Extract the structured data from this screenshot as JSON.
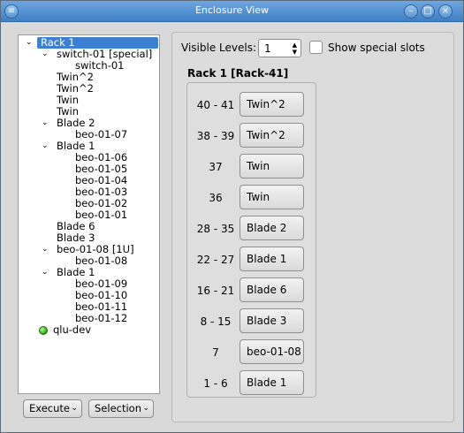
{
  "window": {
    "title": "Enclosure View"
  },
  "tree": {
    "rows": [
      {
        "label": "Rack 1",
        "arrow": "⌄",
        "selected": true
      },
      {
        "label": "switch-01 [special]",
        "arrow": "⌄"
      },
      {
        "label": "switch-01"
      },
      {
        "label": "Twin^2"
      },
      {
        "label": "Twin^2"
      },
      {
        "label": "Twin"
      },
      {
        "label": "Twin"
      },
      {
        "label": "Blade 2",
        "arrow": "⌄"
      },
      {
        "label": "beo-01-07"
      },
      {
        "label": "Blade 1",
        "arrow": "⌄"
      },
      {
        "label": "beo-01-06"
      },
      {
        "label": "beo-01-05"
      },
      {
        "label": "beo-01-04"
      },
      {
        "label": "beo-01-03"
      },
      {
        "label": "beo-01-02"
      },
      {
        "label": "beo-01-01"
      },
      {
        "label": "Blade 6"
      },
      {
        "label": "Blade 3"
      },
      {
        "label": "beo-01-08 [1U]",
        "arrow": "⌄"
      },
      {
        "label": "beo-01-08"
      },
      {
        "label": "Blade 1",
        "arrow": "⌄"
      },
      {
        "label": "beo-01-09"
      },
      {
        "label": "beo-01-10"
      },
      {
        "label": "beo-01-11"
      },
      {
        "label": "beo-01-12"
      },
      {
        "label": "qlu-dev",
        "status": "online"
      }
    ]
  },
  "buttons": {
    "execute": "Execute",
    "selection": "Selection",
    "caret": "⌄"
  },
  "controls": {
    "visible_levels_label": "Visible Levels:",
    "visible_levels_value": "1",
    "show_special_label": "Show special slots",
    "show_special_checked": false
  },
  "rack": {
    "title": "Rack 1 [Rack-41]",
    "slots": [
      {
        "range": "40 - 41",
        "name": "Twin^2"
      },
      {
        "range": "38 - 39",
        "name": "Twin^2"
      },
      {
        "range": "37",
        "name": "Twin"
      },
      {
        "range": "36",
        "name": "Twin"
      },
      {
        "range": "28 - 35",
        "name": "Blade 2"
      },
      {
        "range": "22 - 27",
        "name": "Blade 1"
      },
      {
        "range": "16 - 21",
        "name": "Blade 6"
      },
      {
        "range": "8 - 15",
        "name": "Blade 3"
      },
      {
        "range": "7",
        "name": "beo-01-08"
      },
      {
        "range": "1 - 6",
        "name": "Blade 1"
      }
    ]
  },
  "colors": {
    "titlebar": "#4a88cf",
    "selection": "#3d7fd1",
    "status_online": "#2ea10e"
  }
}
